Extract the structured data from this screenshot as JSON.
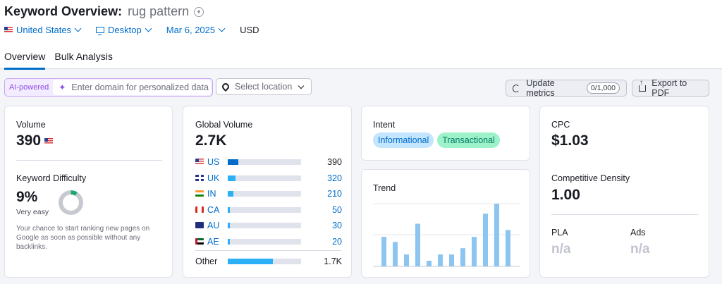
{
  "header": {
    "title": "Keyword Overview:",
    "keyword": "rug pattern",
    "filters": {
      "country": "United States",
      "device": "Desktop",
      "date": "Mar 6, 2025",
      "currency": "USD"
    },
    "tabs": [
      "Overview",
      "Bulk Analysis"
    ]
  },
  "toolbar": {
    "ai_badge": "AI-powered",
    "domain_placeholder": "Enter domain for personalized data",
    "location_placeholder": "Select location",
    "update_label": "Update metrics",
    "update_count": "0/1,000",
    "export_label": "Export to PDF"
  },
  "volume": {
    "label": "Volume",
    "value": "390",
    "kd_label": "Keyword Difficulty",
    "kd_value": "9%",
    "kd_percent": 9,
    "kd_text": "Very easy",
    "kd_hint": "Your chance to start ranking new pages on Google as soon as possible without any backlinks."
  },
  "global": {
    "label": "Global Volume",
    "value": "2.7K",
    "countries": [
      {
        "code": "US",
        "value": "390",
        "share": 0.14,
        "flag": "us"
      },
      {
        "code": "UK",
        "value": "320",
        "share": 0.11,
        "flag": "uk"
      },
      {
        "code": "IN",
        "value": "210",
        "share": 0.075,
        "flag": "in"
      },
      {
        "code": "CA",
        "value": "50",
        "share": 0.02,
        "flag": "ca"
      },
      {
        "code": "AU",
        "value": "30",
        "share": 0.015,
        "flag": "au"
      },
      {
        "code": "AE",
        "value": "20",
        "share": 0.01,
        "flag": "ae"
      }
    ],
    "other": {
      "label": "Other",
      "value": "1.7K",
      "share": 0.62
    }
  },
  "intent": {
    "label": "Intent",
    "tags": [
      "Informational",
      "Transactional"
    ],
    "tag_colors": {
      "informational_bg": "#c4e5fe",
      "informational_fg": "#006dca",
      "transactional_bg": "#9ef2c9",
      "transactional_fg": "#007c65"
    }
  },
  "trend": {
    "label": "Trend",
    "values": [
      0.47,
      0.39,
      0.19,
      0.68,
      0.09,
      0.19,
      0.19,
      0.29,
      0.47,
      0.84,
      1.0,
      0.58
    ],
    "bar_color": "#8bc5f0"
  },
  "cpc": {
    "label": "CPC",
    "value": "$1.03",
    "density_label": "Competitive Density",
    "density_value": "1.00",
    "pla_label": "PLA",
    "pla_value": "n/a",
    "ads_label": "Ads",
    "ads_value": "n/a"
  }
}
